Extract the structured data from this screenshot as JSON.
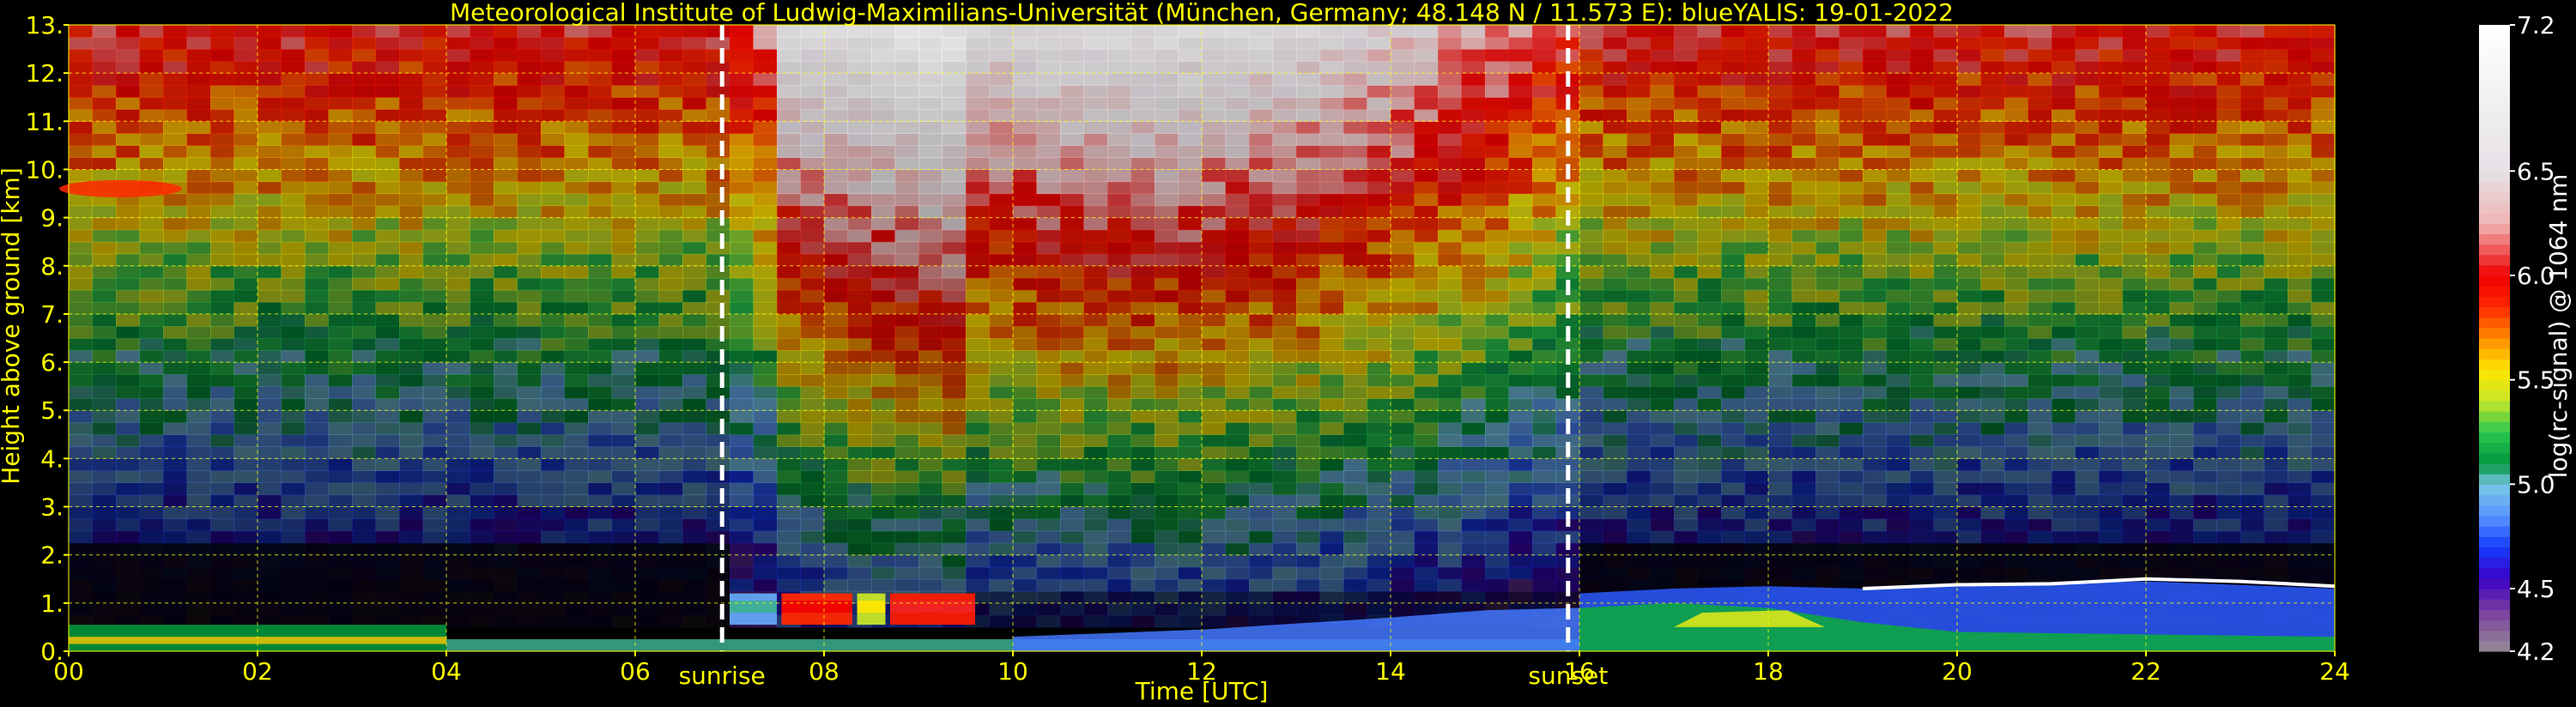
{
  "chart_data": {
    "type": "heatmap",
    "title": "Meteorological Institute of Ludwig-Maximilians-Universität (München, Germany; 48.148 N / 11.573 E):     blueYALIS: 19-01-2022",
    "xlabel": "Time [UTC]",
    "ylabel": "Height above ground [km]",
    "xlim": [
      0,
      24
    ],
    "ylim": [
      0,
      13
    ],
    "x_ticks": [
      "00",
      "02",
      "04",
      "06",
      "08",
      "10",
      "12",
      "14",
      "16",
      "18",
      "20",
      "22",
      "24"
    ],
    "y_ticks": [
      "0.",
      "1.",
      "2.",
      "3.",
      "4.",
      "5.",
      "6.",
      "7.",
      "8.",
      "9.",
      "10.",
      "11.",
      "12.",
      "13."
    ],
    "grid": true,
    "grid_color": "#ffff00",
    "annotations": [
      {
        "label": "sunrise",
        "x": 6.92
      },
      {
        "label": "sunset",
        "x": 15.88
      }
    ],
    "colorbar": {
      "label": "log(rc-signal) @ 1064 nm",
      "range": [
        4.2,
        7.2
      ],
      "tick_labels": [
        "4.2",
        "4.5",
        "5.0",
        "5.5",
        "6.0",
        "6.5",
        "7.2"
      ],
      "tick_values": [
        4.2,
        4.5,
        5.0,
        5.5,
        6.0,
        6.5,
        7.2
      ]
    },
    "features": [
      {
        "kind": "aerosol-layer",
        "x": [
          0,
          4.0
        ],
        "top": 0.55,
        "value": 5.1
      },
      {
        "kind": "low-cloud",
        "x": [
          7.0,
          9.6
        ],
        "bottom": 0.5,
        "top": 1.2,
        "value": 6.0
      },
      {
        "kind": "boundary-layer",
        "x": [
          16,
          24
        ],
        "top": 1.4,
        "value": 5.3
      },
      {
        "kind": "elevated-aerosol",
        "x": [
          0,
          1.3
        ],
        "height": 9.5,
        "value": 6.0
      }
    ]
  },
  "colors": {
    "background": "#000000",
    "text": "#ffff00",
    "annotation_lines": "#ffffff",
    "colorbar_label": "#ffffff"
  }
}
